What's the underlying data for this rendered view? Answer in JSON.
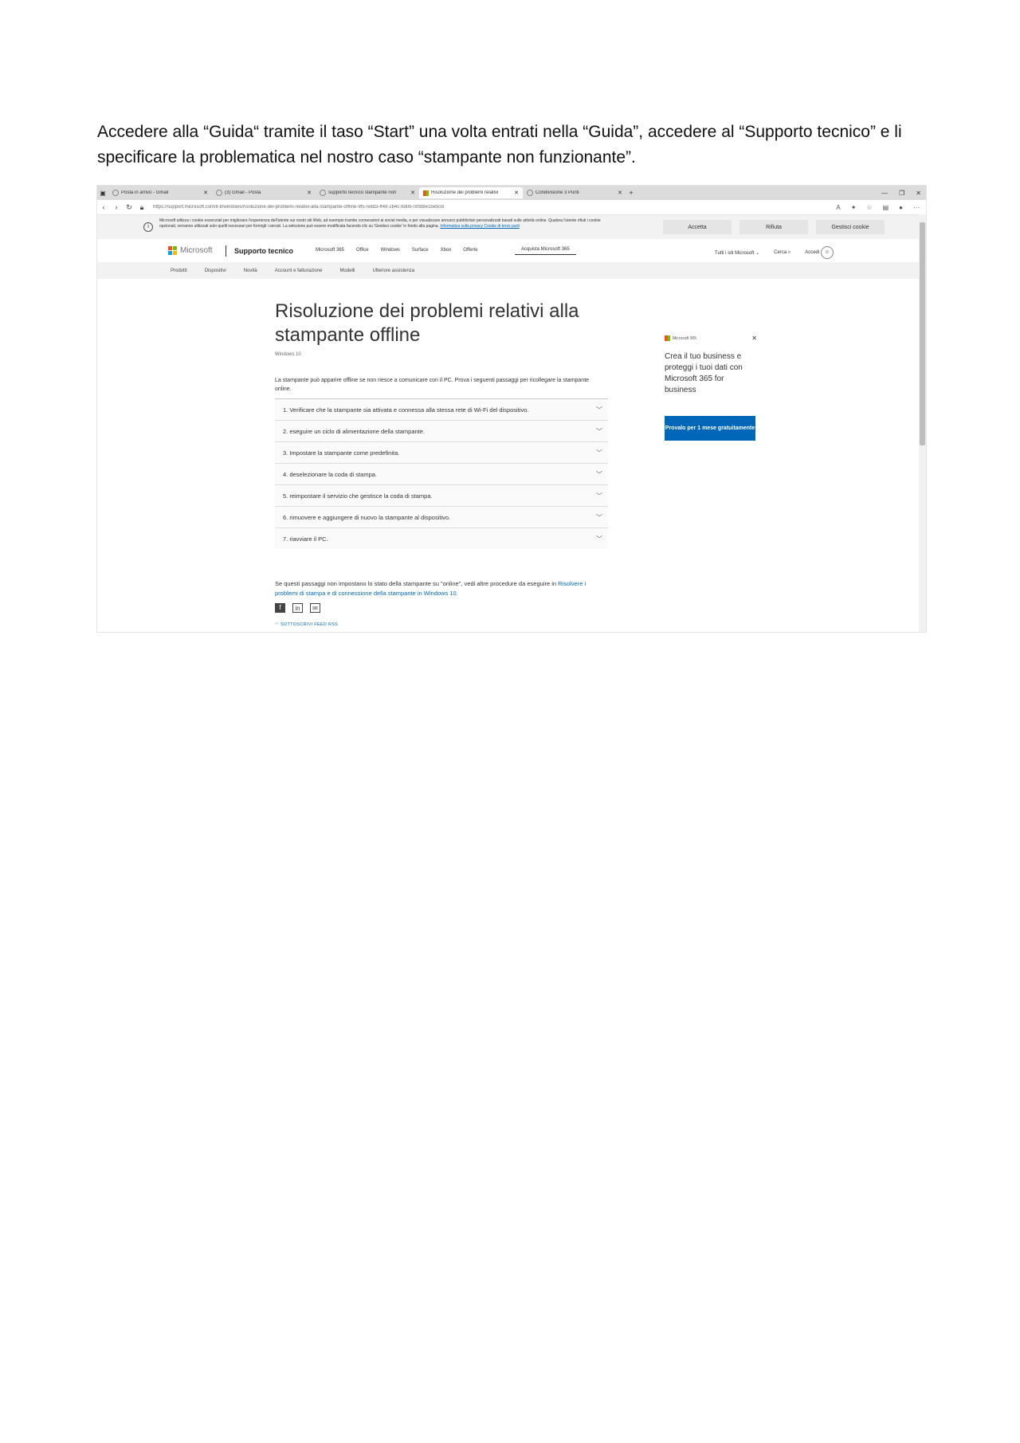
{
  "intro_text": "Accedere alla “Guida“  tramite il taso “Start” una volta entrati nella “Guida”, accedere al “Supporto tecnico” e li specificare la problematica nel nostro caso “stampante non funzionante”.",
  "browser": {
    "tabs": [
      {
        "label": "Posta in arrivo - Gmail",
        "active": false
      },
      {
        "label": "(3) Gmail - Posta",
        "active": false
      },
      {
        "label": "supporto tecnico stampante non",
        "active": false
      },
      {
        "label": "Risoluzione dei problemi relativi",
        "active": true
      },
      {
        "label": "Condivisione 3 Punti",
        "active": false
      }
    ],
    "url": "https://support.microsoft.com/it-it/windows/risoluzione-dei-problemi-relativi-alla-stampante-offline-9f57e8d3-ff49-2b4c-8d0b-00fd8e1be50d"
  },
  "cookie_banner": {
    "text": "Microsoft utilizza i cookie essenziali per migliorare l'esperienza dell'utente sui nostri siti Web, ad esempio tramite connessioni ai social media, e per visualizzare annunci pubblicitari personalizzati basati sulle attività online. Qualora l'utente rifiuti i cookie opzionali, verranno utilizzati solo quelli necessari per fornirgli i servizi. La selezione può essere modificata facendo clic su 'Gestisci cookie' in fondo alla pagina.",
    "links": "Informativa sulla privacy  Cookie di terze parti",
    "accept_label": "Accetta",
    "reject_label": "Rifiuta",
    "manage_label": "Gestisci cookie"
  },
  "header": {
    "logo_text": "Microsoft",
    "support_label": "Supporto tecnico",
    "nav": [
      "Microsoft 365",
      "Office",
      "Windows",
      "Surface",
      "Xbox",
      "Offerte"
    ],
    "buy_label": "Acquista Microsoft 365",
    "all_microsoft": "Tutti i siti Microsoft",
    "search_label": "Cerca",
    "signin_label": "Accedi"
  },
  "subnav": [
    "Prodotti",
    "Dispositivi",
    "Novità",
    "Account e fatturazione",
    "Modelli",
    "Ulteriore assistenza"
  ],
  "article": {
    "title": "Risoluzione dei problemi relativi alla stampante offline",
    "applies_to": "Windows 10",
    "intro": "La stampante può apparire offline se non riesce a comunicare con il PC. Prova i seguenti passaggi per ricollegare la stampante online.",
    "steps": [
      "1. Verificare che la stampante sia attivata e connessa alla stessa rete di Wi-Fi del dispositivo.",
      "2. eseguire un ciclo di alimentazione della stampante.",
      "3. Impostare la stampante come predefinita.",
      "4. deselezionare la coda di stampa.",
      "5. reimpostare il servizio che gestisce la coda di stampa.",
      "6. rimuovere e aggiungere di nuovo la stampante al dispositivo.",
      "7. riavviare il PC."
    ],
    "after_text": "Se questi passaggi non impostano lo stato della stampante su \"online\", vedi altre procedure da eseguire in",
    "after_link": "Risolvere i problemi di stampa e di connessione della stampante in Windows 10.",
    "rss_label": "SOTTOSCRIVI FEED RSS"
  },
  "ad": {
    "brand": "Microsoft 365",
    "text": "Crea il tuo business e proteggi i tuoi dati con Microsoft 365 for business",
    "button": "Provalo per 1 mese gratuitamente"
  },
  "colors": {
    "accent": "#0067b8"
  }
}
